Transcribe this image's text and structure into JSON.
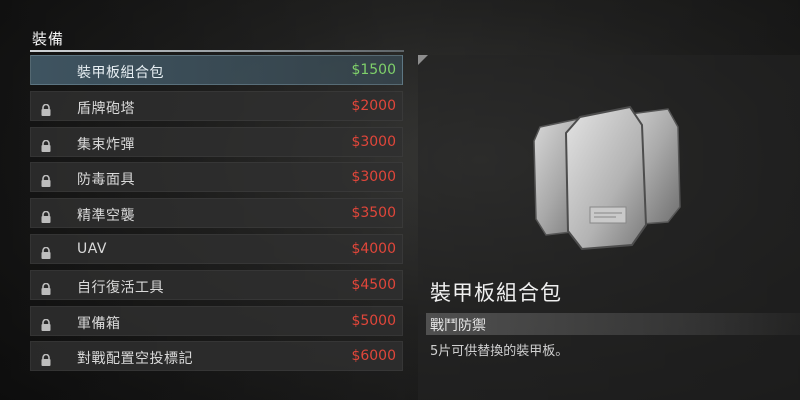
{
  "section": {
    "title": "裝備"
  },
  "items": [
    {
      "name": "裝甲板組合包",
      "price": "$1500",
      "locked": false,
      "selected": true,
      "lock_icon": "lock-icon"
    },
    {
      "name": "盾牌砲塔",
      "price": "$2000",
      "locked": true,
      "selected": false,
      "lock_icon": "lock-icon"
    },
    {
      "name": "集束炸彈",
      "price": "$3000",
      "locked": true,
      "selected": false,
      "lock_icon": "lock-icon"
    },
    {
      "name": "防毒面具",
      "price": "$3000",
      "locked": true,
      "selected": false,
      "lock_icon": "lock-icon"
    },
    {
      "name": "精準空襲",
      "price": "$3500",
      "locked": true,
      "selected": false,
      "lock_icon": "lock-icon"
    },
    {
      "name": "UAV",
      "price": "$4000",
      "locked": true,
      "selected": false,
      "lock_icon": "lock-icon"
    },
    {
      "name": "自行復活工具",
      "price": "$4500",
      "locked": true,
      "selected": false,
      "lock_icon": "lock-icon"
    },
    {
      "name": "軍備箱",
      "price": "$5000",
      "locked": true,
      "selected": false,
      "lock_icon": "lock-icon"
    },
    {
      "name": "對戰配置空投標記",
      "price": "$6000",
      "locked": true,
      "selected": false,
      "lock_icon": "lock-icon"
    }
  ],
  "detail": {
    "name": "裝甲板組合包",
    "category": "戰鬥防禦",
    "description": "5片可供替換的裝甲板。",
    "image_icon": "armor-plates-icon"
  },
  "colors": {
    "price_affordable": "#7fd06a",
    "price_locked": "#e0463a",
    "lock": "#bdbdbd"
  }
}
